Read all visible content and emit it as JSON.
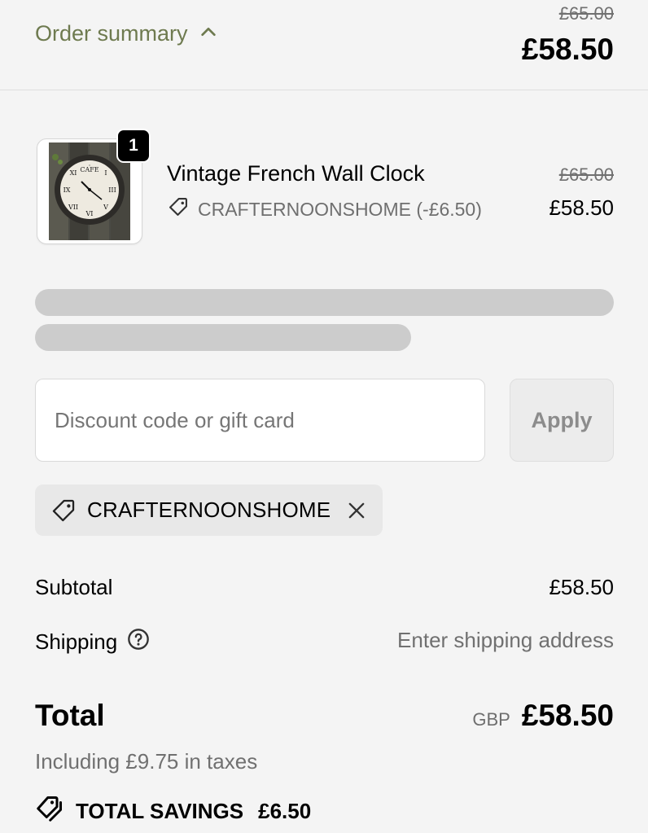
{
  "header": {
    "toggle_label": "Order summary",
    "original_total": "£65.00",
    "total": "£58.50"
  },
  "product": {
    "quantity": "1",
    "name": "Vintage French Wall Clock",
    "discount_label": "CRAFTERNOONSHOME (-£6.50)",
    "original_price": "£65.00",
    "price": "£58.50",
    "clock_face_text": "CAFE"
  },
  "discount": {
    "placeholder": "Discount code or gift card",
    "apply_label": "Apply",
    "applied_code": "CRAFTERNOONSHOME"
  },
  "totals": {
    "subtotal_label": "Subtotal",
    "subtotal_value": "£58.50",
    "shipping_label": "Shipping",
    "shipping_value": "Enter shipping address",
    "total_label": "Total",
    "currency": "GBP",
    "total_value": "£58.50",
    "taxes_note": "Including £9.75 in taxes",
    "savings_label": "TOTAL SAVINGS",
    "savings_value": "£6.50"
  },
  "colors": {
    "accent": "#6e7a4f",
    "background": "#f4f4f4",
    "muted_text": "#707070",
    "skeleton": "#cccccc"
  },
  "icons": {
    "toggle": "chevron-up-icon",
    "discount_tag": "tag-icon",
    "remove": "close-icon",
    "shipping_help": "question-circle-icon",
    "savings": "tags-icon"
  }
}
